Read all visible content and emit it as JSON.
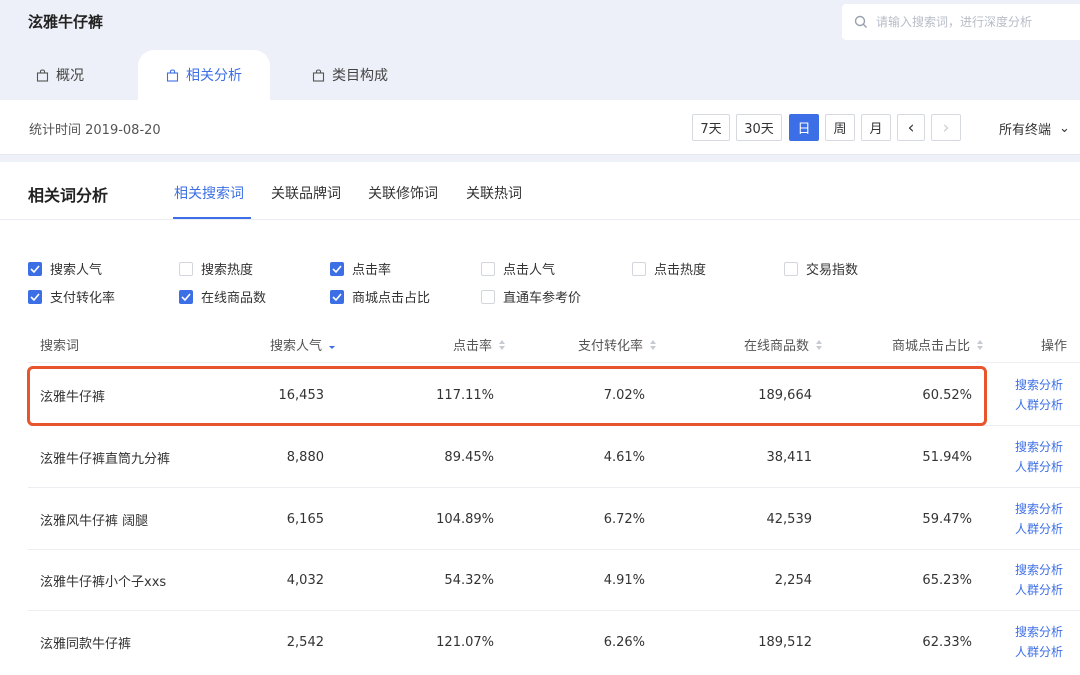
{
  "app": {
    "title": "泫雅牛仔裤"
  },
  "search": {
    "placeholder": "请输入搜索词，进行深度分析"
  },
  "main_tabs": [
    {
      "label": "概况",
      "active": false
    },
    {
      "label": "相关分析",
      "active": true
    },
    {
      "label": "类目构成",
      "active": false
    }
  ],
  "toolbar": {
    "stat_time": "统计时间 2019-08-20",
    "range_7": "7天",
    "range_30": "30天",
    "day": "日",
    "week": "周",
    "month": "月",
    "prev": "‹",
    "next": "›",
    "terminal": "所有终端",
    "terminal_caret": "⌄"
  },
  "panel": {
    "title": "相关词分析",
    "tabs": [
      "相关搜索词",
      "关联品牌词",
      "关联修饰词",
      "关联热词"
    ]
  },
  "metrics": [
    {
      "label": "搜索人气",
      "checked": true
    },
    {
      "label": "搜索热度",
      "checked": false
    },
    {
      "label": "点击率",
      "checked": true
    },
    {
      "label": "点击人气",
      "checked": false
    },
    {
      "label": "点击热度",
      "checked": false
    },
    {
      "label": "交易指数",
      "checked": false
    },
    {
      "label": "支付转化率",
      "checked": true
    },
    {
      "label": "在线商品数",
      "checked": true
    },
    {
      "label": "商城点击占比",
      "checked": true
    },
    {
      "label": "直通车参考价",
      "checked": false
    }
  ],
  "table": {
    "columns": [
      "搜索词",
      "搜索人气",
      "点击率",
      "支付转化率",
      "在线商品数",
      "商城点击占比",
      "操作"
    ],
    "rows": [
      {
        "term": "泫雅牛仔裤",
        "popularity": "16,453",
        "ctr": "117.11%",
        "conversion": "7.02%",
        "online": "189,664",
        "mall_ratio": "60.52%",
        "op1": "搜索分析",
        "op2": "人群分析"
      },
      {
        "term": "泫雅牛仔裤直筒九分裤",
        "popularity": "8,880",
        "ctr": "89.45%",
        "conversion": "4.61%",
        "online": "38,411",
        "mall_ratio": "51.94%",
        "op1": "搜索分析",
        "op2": "人群分析"
      },
      {
        "term": "泫雅风牛仔裤 阔腿",
        "popularity": "6,165",
        "ctr": "104.89%",
        "conversion": "6.72%",
        "online": "42,539",
        "mall_ratio": "59.47%",
        "op1": "搜索分析",
        "op2": "人群分析"
      },
      {
        "term": "泫雅牛仔裤小个子xxs",
        "popularity": "4,032",
        "ctr": "54.32%",
        "conversion": "4.91%",
        "online": "2,254",
        "mall_ratio": "65.23%",
        "op1": "搜索分析",
        "op2": "人群分析"
      },
      {
        "term": "泫雅同款牛仔裤",
        "popularity": "2,542",
        "ctr": "121.07%",
        "conversion": "6.26%",
        "online": "189,512",
        "mall_ratio": "62.33%",
        "op1": "搜索分析",
        "op2": "人群分析"
      }
    ]
  },
  "colors": {
    "accent": "#3c6fe6",
    "highlight": "#e8542b"
  }
}
